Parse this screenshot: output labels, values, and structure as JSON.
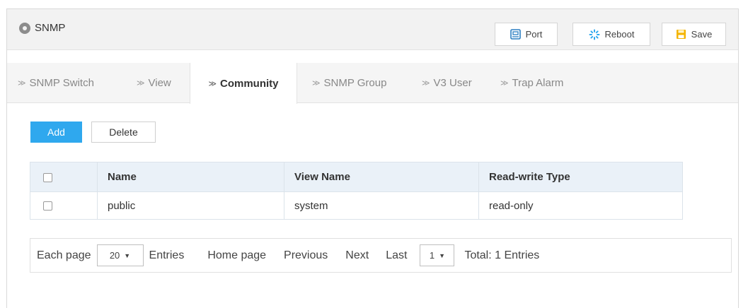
{
  "header": {
    "title": "SNMP",
    "buttons": {
      "port": "Port",
      "reboot": "Reboot",
      "save": "Save"
    }
  },
  "tabs": [
    {
      "label": "SNMP Switch",
      "active": false
    },
    {
      "label": "View",
      "active": false
    },
    {
      "label": "Community",
      "active": true
    },
    {
      "label": "SNMP Group",
      "active": false
    },
    {
      "label": "V3 User",
      "active": false
    },
    {
      "label": "Trap Alarm",
      "active": false
    }
  ],
  "actions": {
    "add": "Add",
    "delete": "Delete"
  },
  "table": {
    "columns": [
      "Name",
      "View Name",
      "Read-write Type"
    ],
    "rows": [
      {
        "name": "public",
        "view_name": "system",
        "rw_type": "read-only"
      }
    ]
  },
  "pager": {
    "each_page": "Each page",
    "page_size": "20",
    "entries": "Entries",
    "home": "Home page",
    "previous": "Previous",
    "next": "Next",
    "last": "Last",
    "current_page": "1",
    "total": "Total: 1 Entries"
  },
  "colors": {
    "accent": "#2fa8ee",
    "save_icon": "#f4b400",
    "port_icon": "#2b7fc2",
    "reboot_icon": "#2fa8ee"
  },
  "icons": {
    "title": "circle-icon",
    "port": "port-icon",
    "reboot": "reboot-spinner-icon",
    "save": "floppy-icon",
    "tab": "chevron-right-icon"
  }
}
